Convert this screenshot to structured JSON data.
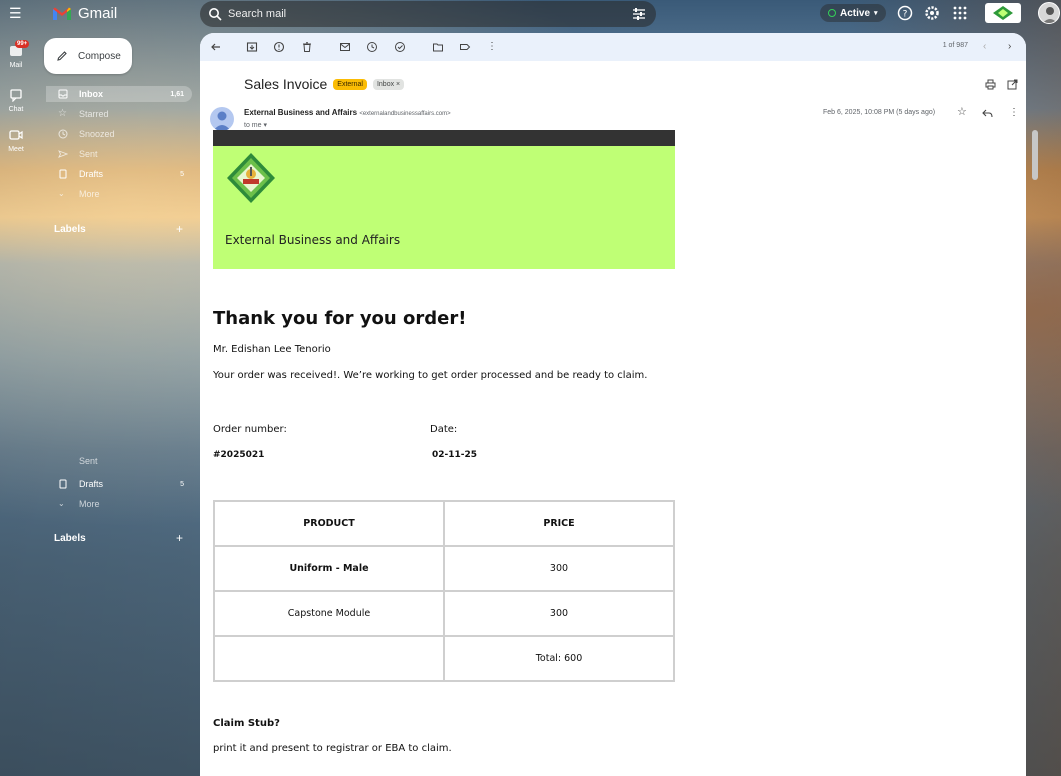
{
  "topbar": {
    "app_name": "Gmail",
    "search_placeholder": "Search mail",
    "status": "Active"
  },
  "rail": {
    "mail_badge": "99+",
    "items": [
      {
        "label": "Mail"
      },
      {
        "label": "Chat"
      },
      {
        "label": "Meet"
      }
    ]
  },
  "nav": {
    "compose_label": "Compose",
    "items": [
      {
        "label": "Inbox",
        "count": "1,61",
        "icon": "inbox-icon",
        "selected": true
      },
      {
        "label": "Starred",
        "count": "",
        "icon": "star-icon"
      },
      {
        "label": "Snoozed",
        "count": "",
        "icon": "clock-icon"
      },
      {
        "label": "Sent",
        "count": "",
        "icon": "send-icon"
      },
      {
        "label": "Drafts",
        "count": "5",
        "icon": "draft-icon"
      },
      {
        "label": "More",
        "count": "",
        "icon": "chevron-down-icon"
      }
    ],
    "labels_header": "Labels",
    "labels_add": "+",
    "dup_items": [
      {
        "label": "Sent"
      },
      {
        "label": "Drafts",
        "count": "5"
      },
      {
        "label": "More"
      }
    ]
  },
  "toolbar": {
    "pager": "1 of 987"
  },
  "message": {
    "subject": "Sales Invoice",
    "tag_external": "External",
    "tag_inbox": "Inbox ×",
    "sender_name": "External Business and Affairs",
    "sender_email": "<externalandbusinessaffairs.com>",
    "to": "to me ▾",
    "date": "Feb 6, 2025, 10:08 PM (5 days ago)"
  },
  "email": {
    "org_name": "External Business and Affairs",
    "thanks": "Thank you for you order!",
    "customer": "Mr. Edishan Lee Tenorio",
    "received": "Your order was received!. We’re working to get order processed and be ready to claim.",
    "order_label": "Order number:",
    "date_label": "Date:",
    "order_number": "#2025021",
    "order_date": "02-11-25",
    "table": {
      "headers": [
        "PRODUCT",
        "PRICE"
      ],
      "rows": [
        [
          "Uniform - Male",
          "300"
        ],
        [
          "Capstone Module",
          "300"
        ],
        [
          "",
          "Total: 600"
        ]
      ]
    },
    "claim_header": "Claim Stub?",
    "claim_text": "print it and present to registrar or EBA to claim."
  },
  "colors": {
    "banner_green": "#bfff75",
    "banner_dark": "#333333",
    "tag_external": "#fbbc04"
  }
}
